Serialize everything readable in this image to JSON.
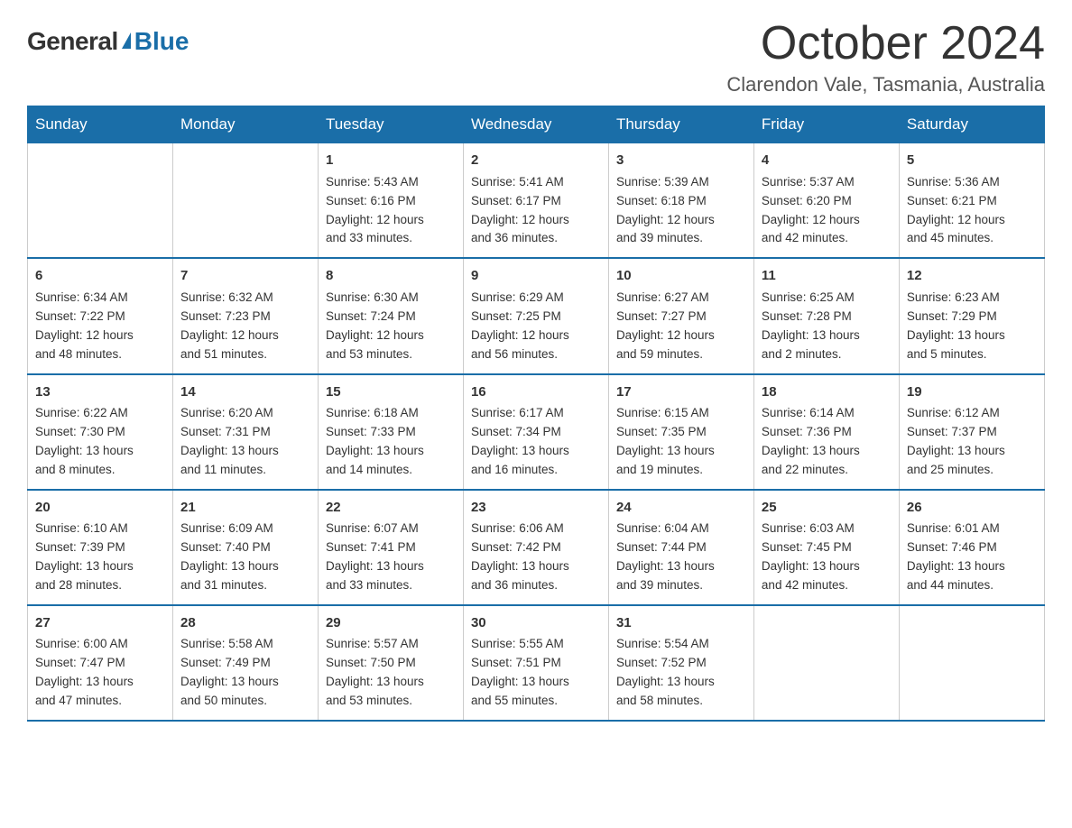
{
  "logo": {
    "general": "General",
    "blue": "Blue"
  },
  "title": "October 2024",
  "location": "Clarendon Vale, Tasmania, Australia",
  "headers": [
    "Sunday",
    "Monday",
    "Tuesday",
    "Wednesday",
    "Thursday",
    "Friday",
    "Saturday"
  ],
  "weeks": [
    [
      {
        "day": "",
        "info": ""
      },
      {
        "day": "",
        "info": ""
      },
      {
        "day": "1",
        "info": "Sunrise: 5:43 AM\nSunset: 6:16 PM\nDaylight: 12 hours\nand 33 minutes."
      },
      {
        "day": "2",
        "info": "Sunrise: 5:41 AM\nSunset: 6:17 PM\nDaylight: 12 hours\nand 36 minutes."
      },
      {
        "day": "3",
        "info": "Sunrise: 5:39 AM\nSunset: 6:18 PM\nDaylight: 12 hours\nand 39 minutes."
      },
      {
        "day": "4",
        "info": "Sunrise: 5:37 AM\nSunset: 6:20 PM\nDaylight: 12 hours\nand 42 minutes."
      },
      {
        "day": "5",
        "info": "Sunrise: 5:36 AM\nSunset: 6:21 PM\nDaylight: 12 hours\nand 45 minutes."
      }
    ],
    [
      {
        "day": "6",
        "info": "Sunrise: 6:34 AM\nSunset: 7:22 PM\nDaylight: 12 hours\nand 48 minutes."
      },
      {
        "day": "7",
        "info": "Sunrise: 6:32 AM\nSunset: 7:23 PM\nDaylight: 12 hours\nand 51 minutes."
      },
      {
        "day": "8",
        "info": "Sunrise: 6:30 AM\nSunset: 7:24 PM\nDaylight: 12 hours\nand 53 minutes."
      },
      {
        "day": "9",
        "info": "Sunrise: 6:29 AM\nSunset: 7:25 PM\nDaylight: 12 hours\nand 56 minutes."
      },
      {
        "day": "10",
        "info": "Sunrise: 6:27 AM\nSunset: 7:27 PM\nDaylight: 12 hours\nand 59 minutes."
      },
      {
        "day": "11",
        "info": "Sunrise: 6:25 AM\nSunset: 7:28 PM\nDaylight: 13 hours\nand 2 minutes."
      },
      {
        "day": "12",
        "info": "Sunrise: 6:23 AM\nSunset: 7:29 PM\nDaylight: 13 hours\nand 5 minutes."
      }
    ],
    [
      {
        "day": "13",
        "info": "Sunrise: 6:22 AM\nSunset: 7:30 PM\nDaylight: 13 hours\nand 8 minutes."
      },
      {
        "day": "14",
        "info": "Sunrise: 6:20 AM\nSunset: 7:31 PM\nDaylight: 13 hours\nand 11 minutes."
      },
      {
        "day": "15",
        "info": "Sunrise: 6:18 AM\nSunset: 7:33 PM\nDaylight: 13 hours\nand 14 minutes."
      },
      {
        "day": "16",
        "info": "Sunrise: 6:17 AM\nSunset: 7:34 PM\nDaylight: 13 hours\nand 16 minutes."
      },
      {
        "day": "17",
        "info": "Sunrise: 6:15 AM\nSunset: 7:35 PM\nDaylight: 13 hours\nand 19 minutes."
      },
      {
        "day": "18",
        "info": "Sunrise: 6:14 AM\nSunset: 7:36 PM\nDaylight: 13 hours\nand 22 minutes."
      },
      {
        "day": "19",
        "info": "Sunrise: 6:12 AM\nSunset: 7:37 PM\nDaylight: 13 hours\nand 25 minutes."
      }
    ],
    [
      {
        "day": "20",
        "info": "Sunrise: 6:10 AM\nSunset: 7:39 PM\nDaylight: 13 hours\nand 28 minutes."
      },
      {
        "day": "21",
        "info": "Sunrise: 6:09 AM\nSunset: 7:40 PM\nDaylight: 13 hours\nand 31 minutes."
      },
      {
        "day": "22",
        "info": "Sunrise: 6:07 AM\nSunset: 7:41 PM\nDaylight: 13 hours\nand 33 minutes."
      },
      {
        "day": "23",
        "info": "Sunrise: 6:06 AM\nSunset: 7:42 PM\nDaylight: 13 hours\nand 36 minutes."
      },
      {
        "day": "24",
        "info": "Sunrise: 6:04 AM\nSunset: 7:44 PM\nDaylight: 13 hours\nand 39 minutes."
      },
      {
        "day": "25",
        "info": "Sunrise: 6:03 AM\nSunset: 7:45 PM\nDaylight: 13 hours\nand 42 minutes."
      },
      {
        "day": "26",
        "info": "Sunrise: 6:01 AM\nSunset: 7:46 PM\nDaylight: 13 hours\nand 44 minutes."
      }
    ],
    [
      {
        "day": "27",
        "info": "Sunrise: 6:00 AM\nSunset: 7:47 PM\nDaylight: 13 hours\nand 47 minutes."
      },
      {
        "day": "28",
        "info": "Sunrise: 5:58 AM\nSunset: 7:49 PM\nDaylight: 13 hours\nand 50 minutes."
      },
      {
        "day": "29",
        "info": "Sunrise: 5:57 AM\nSunset: 7:50 PM\nDaylight: 13 hours\nand 53 minutes."
      },
      {
        "day": "30",
        "info": "Sunrise: 5:55 AM\nSunset: 7:51 PM\nDaylight: 13 hours\nand 55 minutes."
      },
      {
        "day": "31",
        "info": "Sunrise: 5:54 AM\nSunset: 7:52 PM\nDaylight: 13 hours\nand 58 minutes."
      },
      {
        "day": "",
        "info": ""
      },
      {
        "day": "",
        "info": ""
      }
    ]
  ]
}
